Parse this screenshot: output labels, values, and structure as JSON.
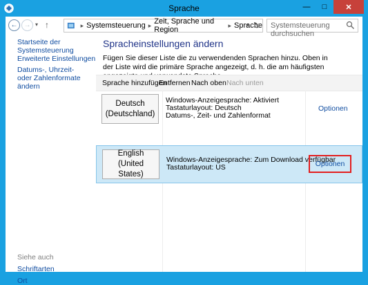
{
  "window": {
    "title": "Sprache",
    "minimize_glyph": "—",
    "maximize_glyph": "□",
    "close_glyph": "✕"
  },
  "address": {
    "crumbs": [
      "Systemsteuerung",
      "Zeit, Sprache und Region",
      "Sprache"
    ],
    "separator": "▸",
    "dropdown_glyph": "▾",
    "refresh_glyph": "↻",
    "back_glyph": "←",
    "forward_glyph": "→",
    "history_glyph": "▾",
    "up_glyph": "↑"
  },
  "search": {
    "placeholder": "Systemsteuerung durchsuchen"
  },
  "sidebar": {
    "links": [
      "Startseite der Systemsteuerung",
      "Erweiterte Einstellungen",
      "Datums-, Uhrzeit- oder Zahlenformate ändern"
    ],
    "see_also_label": "Siehe auch",
    "see_also_links": [
      "Schriftarten",
      "Ort"
    ]
  },
  "main": {
    "heading": "Spracheinstellungen ändern",
    "description": "Fügen Sie dieser Liste die zu verwendenden Sprachen hinzu. Oben in der Liste wird die primäre Sprache angezeigt, d. h. die am häufigsten angezeigte und verwendete Sprache."
  },
  "toolbar": {
    "add": "Sprache hinzufügen",
    "remove": "Entfernen",
    "move_up": "Nach oben",
    "move_down": "Nach unten"
  },
  "languages": [
    {
      "name": "Deutsch (Deutschland)",
      "lines": [
        "Windows-Anzeigesprache: Aktiviert",
        "Tastaturlayout: Deutsch",
        "Datums-, Zeit- und Zahlenformat"
      ],
      "options": "Optionen",
      "selected": false
    },
    {
      "name": "English (United States)",
      "lines": [
        "Windows-Anzeigesprache: Zum Download verfügbar",
        "Tastaturlayout: US"
      ],
      "options": "Optionen",
      "selected": true
    }
  ],
  "icons": [
    "control-panel-icon",
    "search-icon",
    "back-icon",
    "forward-icon",
    "up-icon",
    "refresh-icon"
  ],
  "colors": {
    "frame": "#1aa1e1",
    "link": "#0f4ca0",
    "heading": "#1e3287",
    "selection": "#cde8f7",
    "highlight": "#e31d1d"
  }
}
